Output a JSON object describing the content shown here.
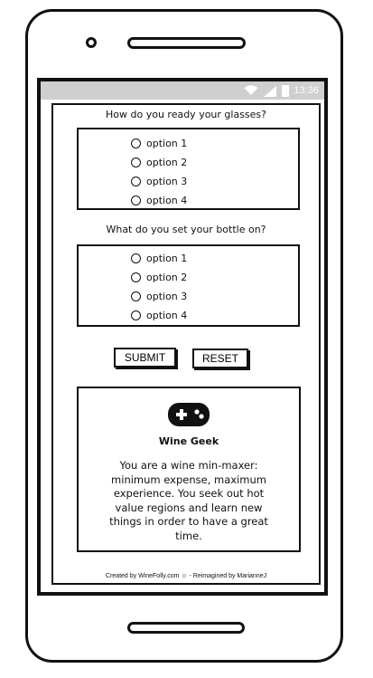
{
  "status_bar": {
    "time": "13:36",
    "icons": [
      "wifi-icon",
      "signal-icon",
      "battery-icon"
    ]
  },
  "quiz": {
    "questions": [
      {
        "text": "How do you ready your glasses?",
        "options": [
          "option 1",
          "option 2",
          "option 3",
          "option 4"
        ]
      },
      {
        "text": "What do you set your bottle on?",
        "options": [
          "option 1",
          "option 2",
          "option 3",
          "option 4"
        ]
      }
    ],
    "submit_label": "SUBMIT",
    "reset_label": "RESET"
  },
  "result": {
    "icon": "gamepad-icon",
    "title": "Wine Geek",
    "description": "You are a wine min-maxer: minimum expense, maximum experience. You seek out hot value regions and learn new things in order to have a great time."
  },
  "footer": {
    "text": "Created by WineFolly.com ☺ - Reimagined by MarianneJ"
  }
}
